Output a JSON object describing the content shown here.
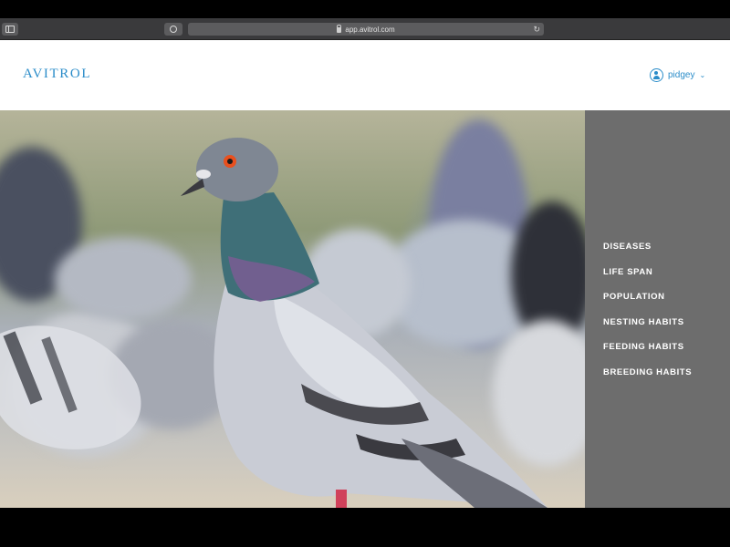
{
  "browser": {
    "url": "app.avitrol.com",
    "reload_icon": "↻"
  },
  "header": {
    "logo_text": "AVITROL",
    "user": {
      "name": "pidgey",
      "chevron": "⌄",
      "icon": "user-circle-icon"
    }
  },
  "hero": {
    "image": "pigeon-flock-photo"
  },
  "nav": {
    "items": [
      {
        "label": "DISEASES"
      },
      {
        "label": "LIFE SPAN"
      },
      {
        "label": "POPULATION"
      },
      {
        "label": "NESTING HABITS"
      },
      {
        "label": "FEEDING HABITS"
      },
      {
        "label": "BREEDING HABITS"
      }
    ]
  },
  "colors": {
    "brand_blue": "#2a8cc9",
    "nav_bg": "#6d6d6d",
    "chrome_bg": "#3a3a3c"
  }
}
